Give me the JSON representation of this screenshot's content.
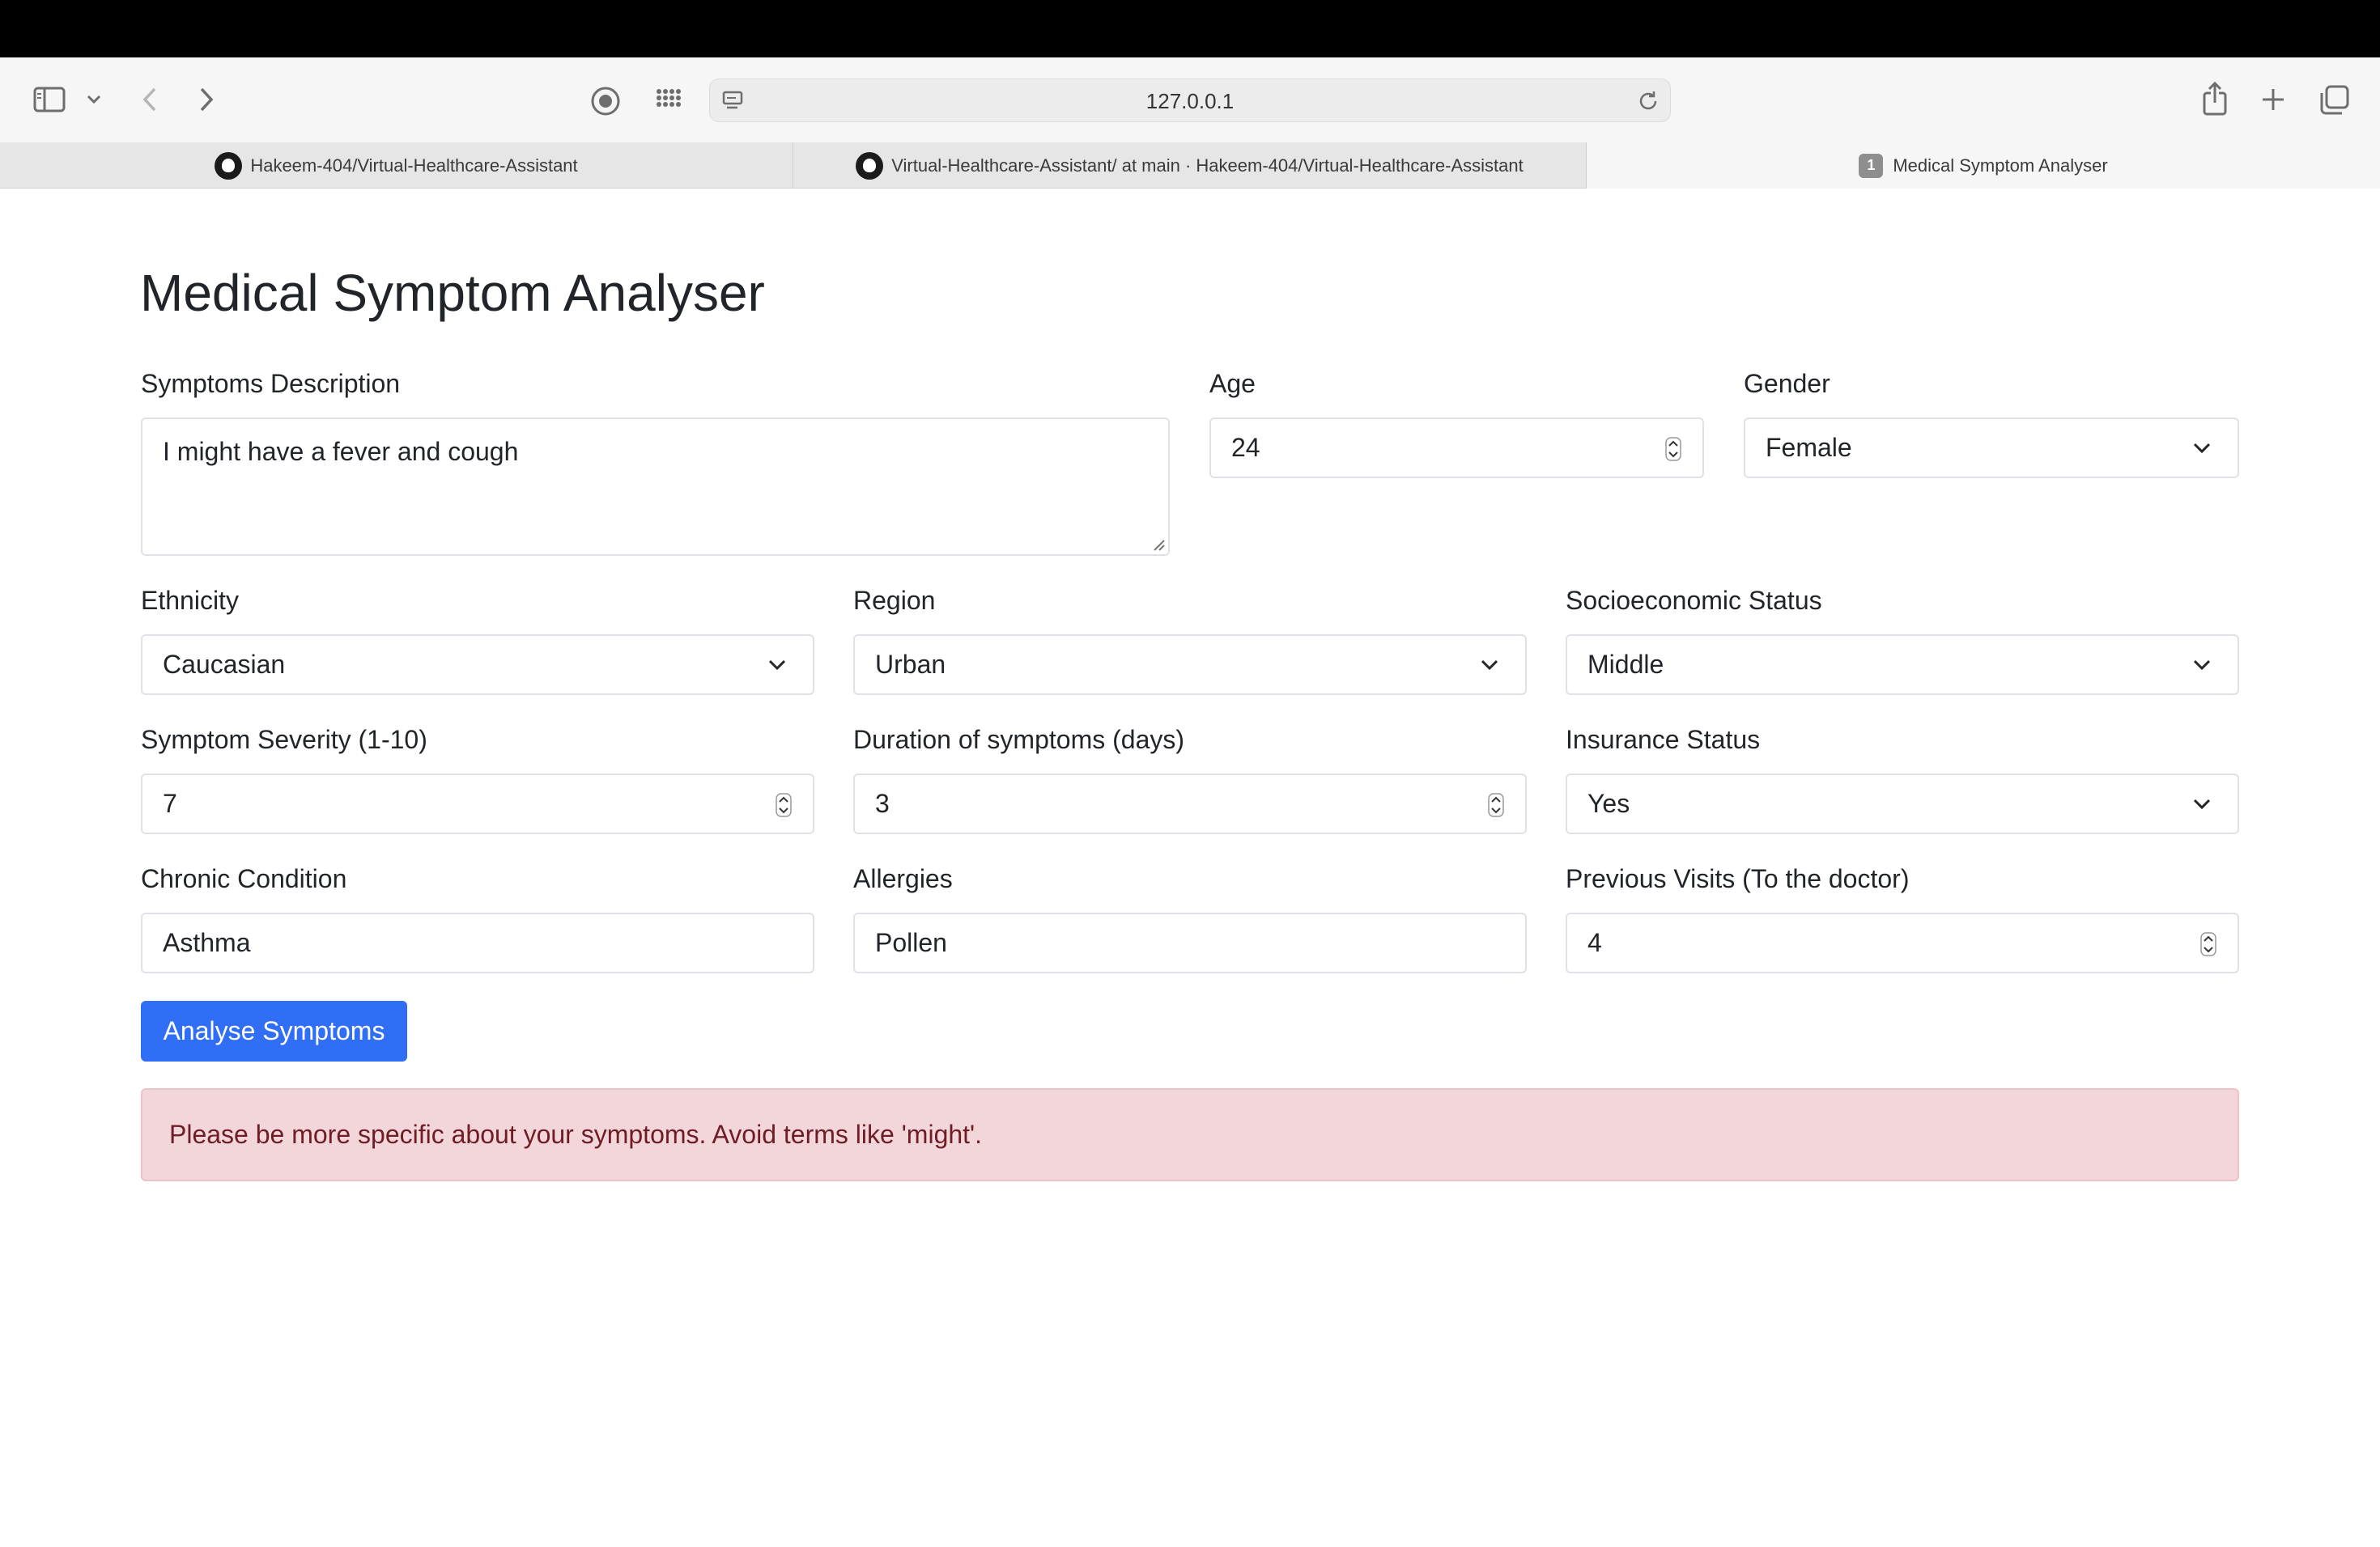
{
  "browser": {
    "url": "127.0.0.1",
    "tabs": [
      {
        "label": "Hakeem-404/Virtual-Healthcare-Assistant",
        "icon": "github-icon"
      },
      {
        "label": "Virtual-Healthcare-Assistant/ at main · Hakeem-404/Virtual-Healthcare-Assistant",
        "icon": "github-icon"
      },
      {
        "label": "Medical Symptom Analyser",
        "badge": "1"
      }
    ]
  },
  "page": {
    "title": "Medical Symptom Analyser"
  },
  "form": {
    "symptoms": {
      "label": "Symptoms Description",
      "value": "I might have a fever and cough"
    },
    "age": {
      "label": "Age",
      "value": "24"
    },
    "gender": {
      "label": "Gender",
      "value": "Female"
    },
    "ethnicity": {
      "label": "Ethnicity",
      "value": "Caucasian"
    },
    "region": {
      "label": "Region",
      "value": "Urban"
    },
    "socioeconomic": {
      "label": "Socioeconomic Status",
      "value": "Middle"
    },
    "severity": {
      "label": "Symptom Severity (1-10)",
      "value": "7"
    },
    "duration": {
      "label": "Duration of symptoms (days)",
      "value": "3"
    },
    "insurance": {
      "label": "Insurance Status",
      "value": "Yes"
    },
    "chronic": {
      "label": "Chronic Condition",
      "value": "Asthma"
    },
    "allergies": {
      "label": "Allergies",
      "value": "Pollen"
    },
    "visits": {
      "label": "Previous Visits (To the doctor)",
      "value": "4"
    },
    "submit_label": "Analyse Symptoms"
  },
  "alert": {
    "message": "Please be more specific about your symptoms. Avoid terms like 'might'."
  },
  "colors": {
    "primary": "#2f6ef5",
    "alert_bg": "#f2d6d9",
    "alert_text": "#6f1c26"
  }
}
